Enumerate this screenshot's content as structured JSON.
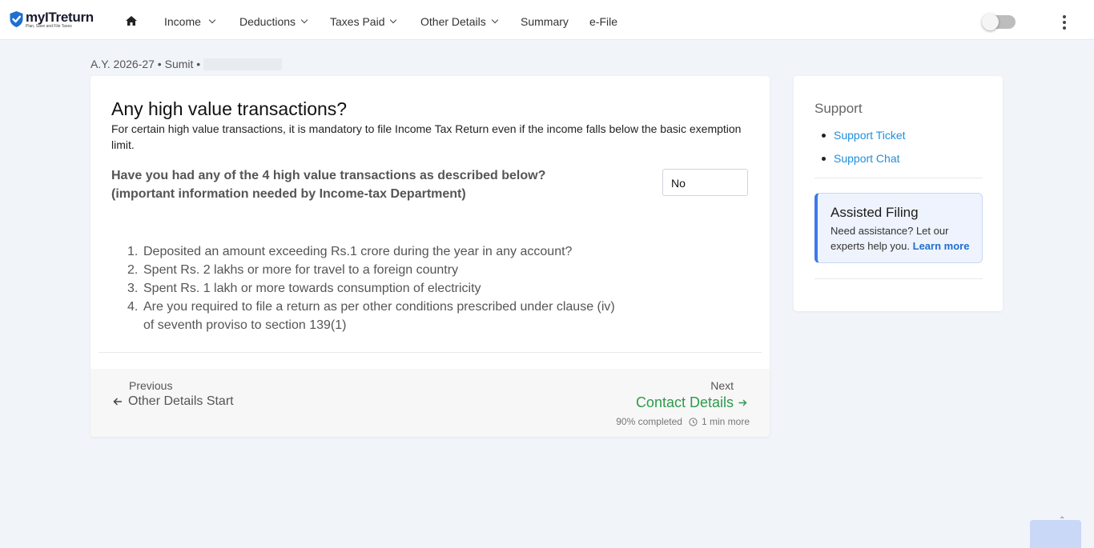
{
  "brand": {
    "name": "myITreturn",
    "tagline": "Plan, Save and File Taxes",
    "color": "#1f6fd0"
  },
  "nav": {
    "items": [
      {
        "label": "Income",
        "dropdown": true
      },
      {
        "label": "Deductions",
        "dropdown": true
      },
      {
        "label": "Taxes Paid",
        "dropdown": true
      },
      {
        "label": "Other Details",
        "dropdown": true
      },
      {
        "label": "Summary",
        "dropdown": false
      },
      {
        "label": "e-File",
        "dropdown": false
      }
    ]
  },
  "breadcrumb": {
    "text": "A.Y. 2026-27 • Sumit •"
  },
  "main": {
    "title": "Any high value transactions?",
    "description": "For certain high value transactions, it is mandatory to file Income Tax Return even if the income falls below the basic exemption limit.",
    "question_line1": "Have you had any of the 4 high value transactions as described below?",
    "question_line2": "(important information needed by Income-tax Department)",
    "answer_value": "No",
    "transactions": [
      {
        "num": "1.",
        "text": "Deposited an amount exceeding Rs.1 crore during the year in any account?"
      },
      {
        "num": "2.",
        "text": "Spent Rs. 2 lakhs or more for travel to a foreign country"
      },
      {
        "num": "3.",
        "text": "Spent Rs. 1 lakh or more towards consumption of electricity"
      },
      {
        "num": "4.",
        "text": "Are you required to file a return as per other conditions prescribed under clause (iv) of seventh proviso to section 139(1)"
      }
    ]
  },
  "footer": {
    "prev_label": "Previous",
    "prev_link": "Other Details Start",
    "next_label": "Next",
    "next_link": "Contact Details",
    "progress_text": "90% completed",
    "time_text": "1 min more",
    "accent": "#2e9a4b"
  },
  "sidebar": {
    "title": "Support",
    "links": [
      {
        "label": "Support Ticket"
      },
      {
        "label": "Support Chat"
      }
    ],
    "assist": {
      "title": "Assisted Filing",
      "text": "Need assistance? Let our experts help you.",
      "link": "Learn more"
    }
  }
}
